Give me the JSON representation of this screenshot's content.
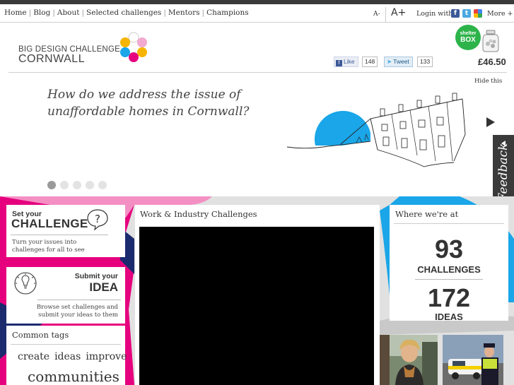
{
  "nav": {
    "items": [
      "Home",
      "Blog",
      "About",
      "Selected challenges",
      "Mentors",
      "Champions"
    ]
  },
  "accessibility": {
    "font_smaller": "A-",
    "font_larger": "A+"
  },
  "login": {
    "label": "Login with:",
    "providers": [
      {
        "name": "facebook",
        "icon": "facebook-icon",
        "glyph": "f",
        "color": "#3b5998"
      },
      {
        "name": "twitter",
        "icon": "twitter-icon",
        "glyph": "t",
        "color": "#4ba9e1"
      },
      {
        "name": "google",
        "icon": "google-icon",
        "glyph": "g",
        "color": "#d9d9d9"
      }
    ],
    "more": "More +"
  },
  "logo": {
    "line1": "BIG DESIGN CHALLENGE",
    "line2": "CORNWALL"
  },
  "social": {
    "like_label": "Like",
    "like_count": "148",
    "tweet_label": "Tweet",
    "tweet_count": "133"
  },
  "sponsor": {
    "line1": "shelter",
    "line2": "BOX",
    "amount": "£46.50",
    "color": "#2db34a"
  },
  "hero": {
    "hide_label": "Hide this",
    "question": "How do we address the issue of unaffordable homes in Cornwall?",
    "slide_count": 5,
    "active_slide": 1
  },
  "feedback": {
    "label": "Feedback"
  },
  "set_challenge": {
    "title_small": "Set your",
    "title_big": "CHALLENGE",
    "description": "Turn your issues into challenges for all to see"
  },
  "submit_idea": {
    "title_small": "Submit your",
    "title_big": "IDEA",
    "description": "Browse set challenges and submit your ideas to them"
  },
  "tags": {
    "heading": "Common tags",
    "small": [
      "create",
      "ideas",
      "improve"
    ],
    "big": "communities"
  },
  "video_panel": {
    "heading": "Work & Industry Challenges"
  },
  "stats": {
    "heading": "Where we're at",
    "challenges_count": "93",
    "challenges_label": "CHALLENGES",
    "ideas_count": "172",
    "ideas_label": "IDEAS"
  },
  "colors": {
    "accent_blue": "#1aa6e8",
    "accent_pink": "#e6007e",
    "navy": "#1c2a6e",
    "panel_bg": "#e1e1e1"
  }
}
